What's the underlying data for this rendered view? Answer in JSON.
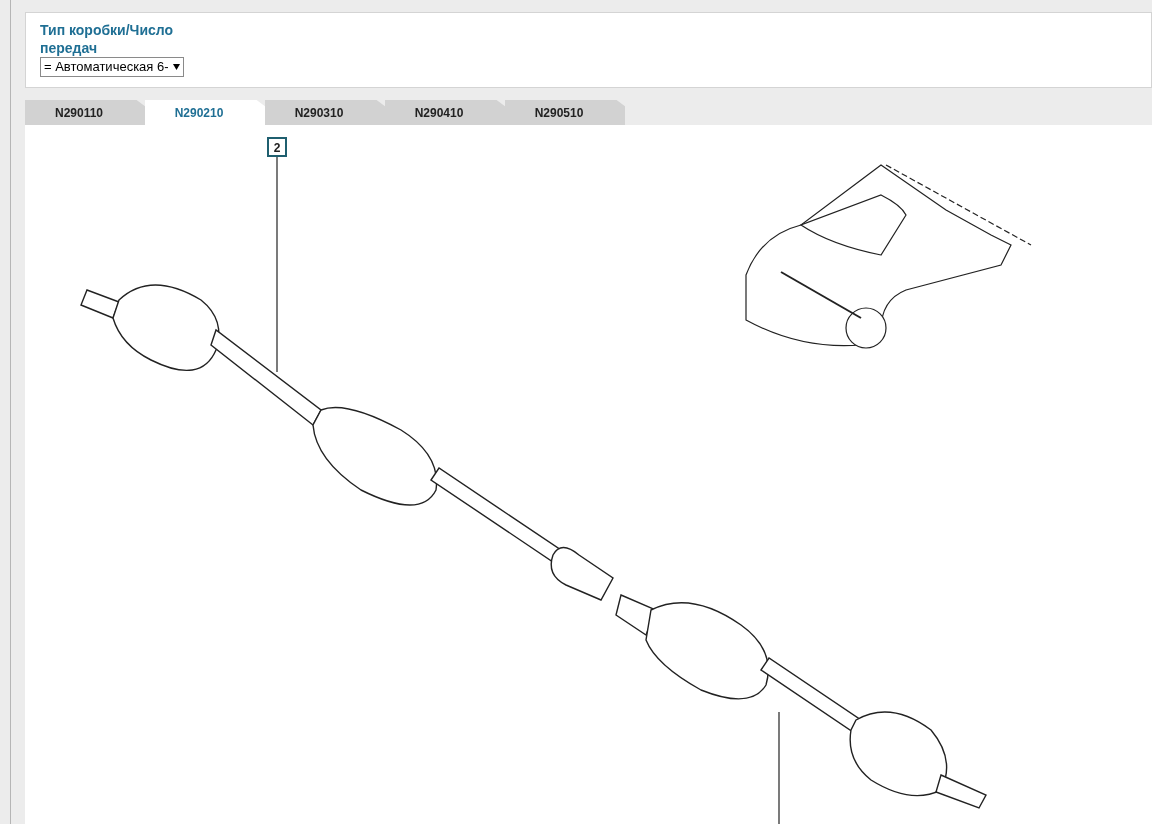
{
  "filter": {
    "label": "Тип коробки/Число передач",
    "value": "= Автоматическая 6-"
  },
  "tabs": [
    {
      "label": "N290110",
      "selected": false
    },
    {
      "label": "N290210",
      "selected": true
    },
    {
      "label": "N290310",
      "selected": false
    },
    {
      "label": "N290410",
      "selected": false
    },
    {
      "label": "N290510",
      "selected": false
    }
  ],
  "diagram": {
    "callouts": [
      {
        "label": "2"
      }
    ]
  }
}
